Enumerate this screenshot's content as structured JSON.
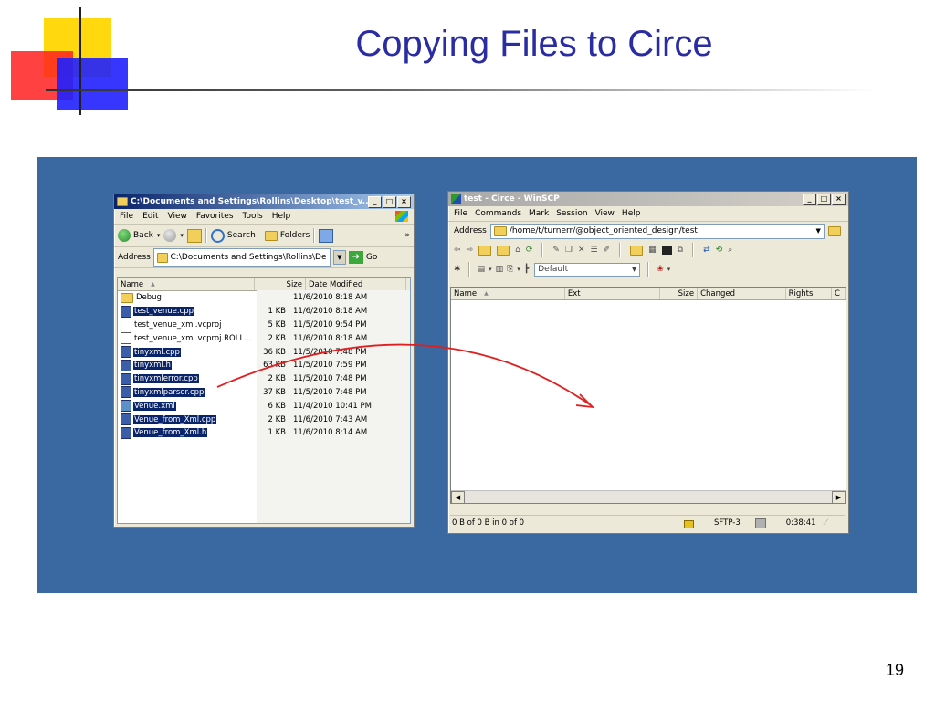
{
  "slide": {
    "title": "Copying Files to Circe",
    "page_number": "19"
  },
  "explorer": {
    "title": "C:\\Documents and Settings\\Rollins\\Desktop\\test_v...",
    "menu": [
      "File",
      "Edit",
      "View",
      "Favorites",
      "Tools",
      "Help"
    ],
    "toolbar": {
      "back": "Back",
      "search": "Search",
      "folders": "Folders",
      "more": "»"
    },
    "address_label": "Address",
    "address_value": "C:\\Documents and Settings\\Rollins\\Desktop\\tes",
    "go_label": "Go",
    "columns": [
      "Name",
      "Size",
      "Date Modified"
    ],
    "sort_indicator": "▲",
    "files": [
      {
        "name": "Debug",
        "size": "",
        "date": "11/6/2010 8:18 AM",
        "icon": "folder-icon",
        "selected": false
      },
      {
        "name": "test_venue.cpp",
        "size": "1 KB",
        "date": "11/6/2010 8:18 AM",
        "icon": "cpp-file-icon",
        "selected": true
      },
      {
        "name": "test_venue_xml.vcproj",
        "size": "5 KB",
        "date": "11/5/2010 9:54 PM",
        "icon": "vcproj-file-icon",
        "selected": false
      },
      {
        "name": "test_venue_xml.vcproj.ROLL...",
        "size": "2 KB",
        "date": "11/6/2010 8:18 AM",
        "icon": "document-icon",
        "selected": false
      },
      {
        "name": "tinyxml.cpp",
        "size": "36 KB",
        "date": "11/5/2010 7:48 PM",
        "icon": "cpp-file-icon",
        "selected": true
      },
      {
        "name": "tinyxml.h",
        "size": "63 KB",
        "date": "11/5/2010 7:59 PM",
        "icon": "header-file-icon",
        "selected": true
      },
      {
        "name": "tinyxmlerror.cpp",
        "size": "2 KB",
        "date": "11/5/2010 7:48 PM",
        "icon": "cpp-file-icon",
        "selected": true
      },
      {
        "name": "tinyxmlparser.cpp",
        "size": "37 KB",
        "date": "11/5/2010 7:48 PM",
        "icon": "cpp-file-icon",
        "selected": true
      },
      {
        "name": "Venue.xml",
        "size": "6 KB",
        "date": "11/4/2010 10:41 PM",
        "icon": "xml-file-icon",
        "selected": true
      },
      {
        "name": "Venue_from_Xml.cpp",
        "size": "2 KB",
        "date": "11/6/2010 7:43 AM",
        "icon": "cpp-file-icon",
        "selected": true
      },
      {
        "name": "Venue_from_Xml.h",
        "size": "1 KB",
        "date": "11/6/2010 8:14 AM",
        "icon": "header-file-icon",
        "selected": true
      }
    ]
  },
  "winscp": {
    "title": "test - Circe - WinSCP",
    "menu": [
      "File",
      "Commands",
      "Mark",
      "Session",
      "View",
      "Help"
    ],
    "address_label": "Address",
    "address_value": "/home/t/turnerr/@object_oriented_design/test",
    "transfer_preset": "Default",
    "columns": [
      "Name",
      "Ext",
      "Size",
      "Changed",
      "Rights",
      "C"
    ],
    "sort_indicator": "▲",
    "status": {
      "info": "0 B of 0 B in 0 of 0",
      "protocol": "SFTP-3",
      "time": "0:38:41"
    }
  },
  "colors": {
    "slide_title": "#2a2ca3",
    "panel_bg": "#3a68a0",
    "explorer_titlebar": "#0a246a",
    "selection": "#0a246a",
    "arrow": "#e02020"
  }
}
